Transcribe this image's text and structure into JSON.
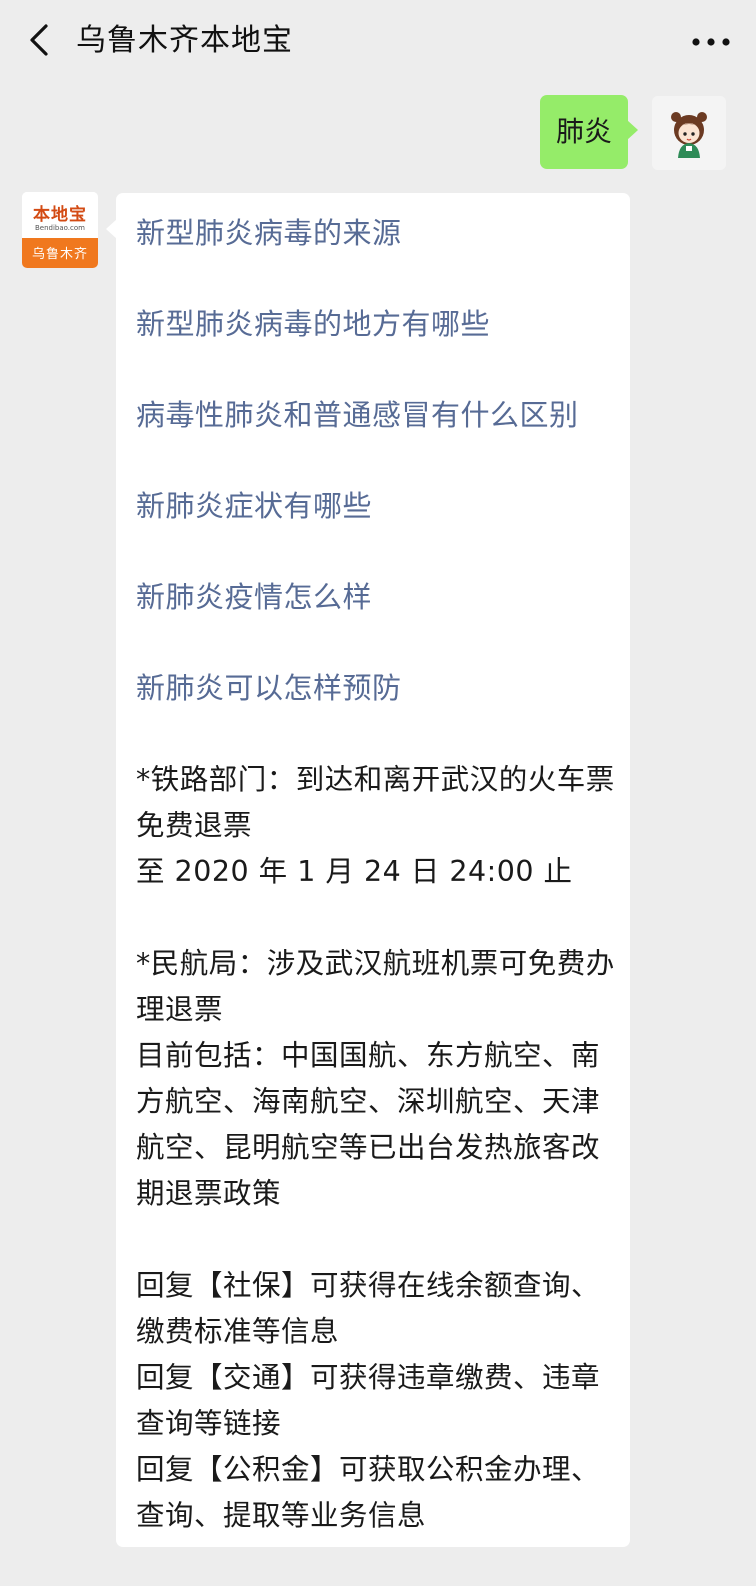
{
  "header": {
    "title": "乌鲁木齐本地宝",
    "back_icon": "chevron-left-icon",
    "more_icon": "ellipsis-icon"
  },
  "user_message": {
    "text": "肺炎"
  },
  "bot_avatar": {
    "logo_text": "本地宝",
    "site_text": "Bendibao.com",
    "city_text": "乌鲁木齐",
    "brand_color": "#f0781e"
  },
  "bot_message": {
    "links": [
      "新型肺炎病毒的来源",
      "新型肺炎病毒的地方有哪些",
      "病毒性肺炎和普通感冒有什么区别",
      "新肺炎症状有哪些",
      "新肺炎疫情怎么样",
      "新肺炎可以怎样预防"
    ],
    "railway": {
      "line1": "*铁路部门：到达和离开武汉的火车票免费退票",
      "line2": "至 2020 年 1 月 24 日 24:00 止"
    },
    "aviation": {
      "line1": "*民航局：涉及武汉航班机票可免费办理退票",
      "line2": "目前包括：中国国航、东方航空、南方航空、海南航空、深圳航空、天津航空、昆明航空等已出台发热旅客改期退票政策"
    },
    "replies": [
      "回复【社保】可获得在线余额查询、缴费标准等信息",
      "回复【交通】可获得违章缴费、违章查询等链接",
      "回复【公积金】可获取公积金办理、查询、提取等业务信息"
    ],
    "link_color": "#576b95"
  },
  "colors": {
    "user_bubble": "#95ec69",
    "background": "#ededed"
  }
}
